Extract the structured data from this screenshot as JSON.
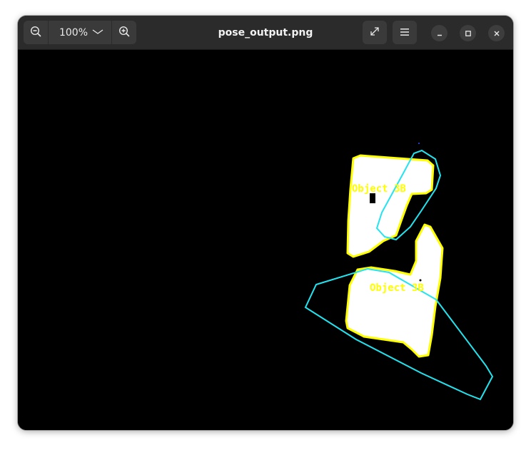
{
  "window": {
    "title": "pose_output.png"
  },
  "toolbar": {
    "zoom_level": "100%",
    "zoom_out_icon": "zoom-out-icon",
    "zoom_in_icon": "zoom-in-icon",
    "zoom_dropdown_icon": "chevron-down-icon",
    "fullscreen_icon": "fullscreen-icon",
    "menu_icon": "hamburger-menu-icon",
    "minimize_icon": "minimize-icon",
    "maximize_icon": "maximize-icon",
    "close_icon": "close-icon"
  },
  "image": {
    "labels": [
      {
        "text": "Object 3B"
      },
      {
        "text": "Object 3B"
      }
    ],
    "colors": {
      "object_fill": "#ffffff",
      "object_outline": "#ffff00",
      "pose_outline": "#22e4f0",
      "background": "#000000"
    }
  }
}
